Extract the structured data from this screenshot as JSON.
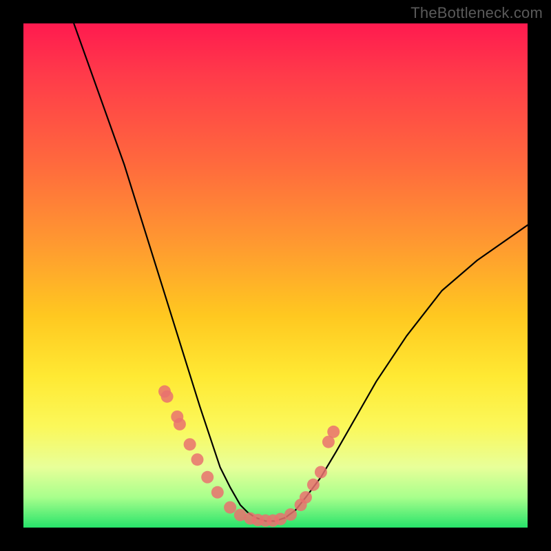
{
  "watermark": "TheBottleneck.com",
  "colors": {
    "dot": "#e9716f",
    "curve": "#000000",
    "gradient_top": "#ff1a4f",
    "gradient_bottom": "#27e36a"
  },
  "chart_data": {
    "type": "line",
    "title": "",
    "xlabel": "",
    "ylabel": "",
    "xlim": [
      0,
      100
    ],
    "ylim": [
      0,
      100
    ],
    "grid": false,
    "note": "No axis ticks or numeric labels are visible; x/y values are estimated as percentages of the plot area (y: 0=bottom, 100=top).",
    "series": [
      {
        "name": "bottleneck-curve",
        "x": [
          10,
          15,
          20,
          25,
          27.5,
          30,
          32.5,
          35,
          37,
          39,
          41,
          43,
          44.5,
          46,
          48,
          50,
          52,
          54,
          56,
          59,
          62,
          66,
          70,
          76,
          83,
          90,
          100
        ],
        "y": [
          100,
          86,
          72,
          56,
          48,
          40,
          32,
          24,
          18,
          12,
          8,
          4.5,
          3,
          2,
          1.3,
          1.3,
          2,
          3.5,
          6,
          10,
          15,
          22,
          29,
          38,
          47,
          53,
          60
        ]
      }
    ],
    "points": {
      "name": "markers",
      "x": [
        28.0,
        28.5,
        30.5,
        31.0,
        33.0,
        34.5,
        36.5,
        38.5,
        41.0,
        43.0,
        45.0,
        46.5,
        48.0,
        49.5,
        51.0,
        53.0,
        55.0,
        56.0,
        57.5,
        59.0,
        60.5,
        61.5
      ],
      "y": [
        27.0,
        26.0,
        22.0,
        20.5,
        16.5,
        13.5,
        10.0,
        7.0,
        4.0,
        2.5,
        1.8,
        1.5,
        1.4,
        1.4,
        1.7,
        2.6,
        4.5,
        6.0,
        8.5,
        11.0,
        17.0,
        19.0
      ]
    }
  }
}
